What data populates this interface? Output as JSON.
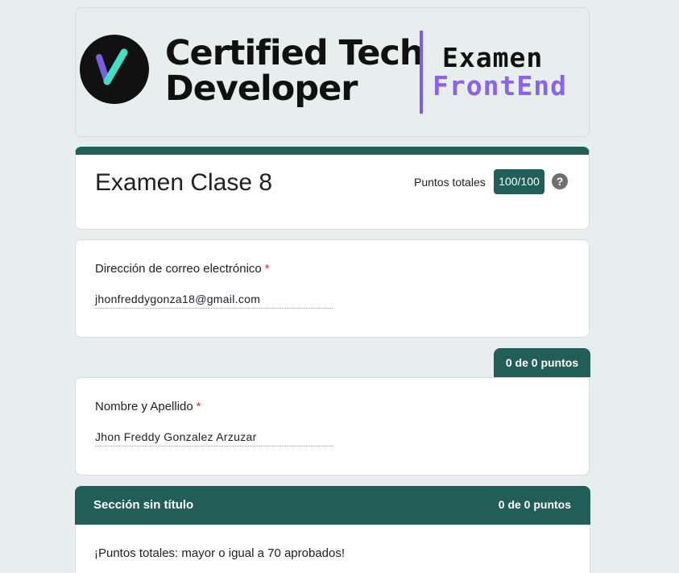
{
  "banner": {
    "brand_line1": "Certified Tech",
    "brand_line2": "Developer",
    "exam_word": "Examen",
    "frontend_word": "FrontEnd",
    "accent_color": "#8a63e8"
  },
  "form": {
    "title": "Examen Clase 8",
    "total_points_label": "Puntos totales",
    "total_points_value": "100/100",
    "help_icon": "?"
  },
  "questions": [
    {
      "label": "Dirección de correo electrónico",
      "required": "*",
      "answer": "jhonfreddygonza18@gmail.com"
    },
    {
      "score": "0 de 0 puntos",
      "label": "Nombre y Apellido",
      "required": "*",
      "answer": "Jhon Freddy Gonzalez Arzuzar"
    }
  ],
  "section": {
    "title": "Sección sin título",
    "points": "0 de 0 puntos",
    "description": "¡Puntos totales: mayor o igual a 70 aprobados!"
  },
  "theme": {
    "primary": "#215e58",
    "background": "#e8eeed"
  }
}
